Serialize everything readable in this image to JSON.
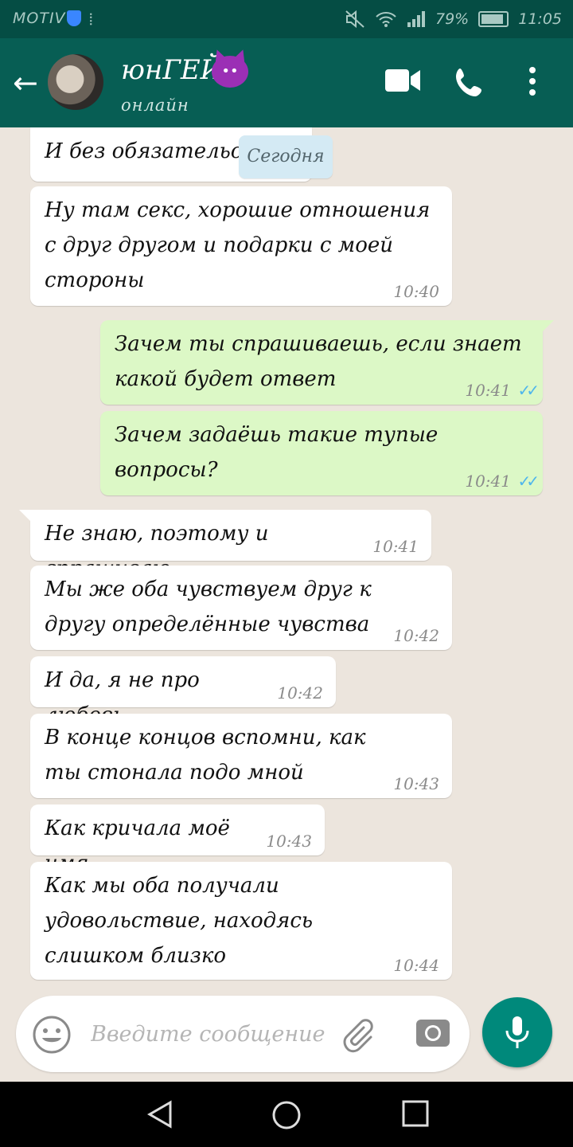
{
  "status_bar": {
    "carrier": "MOTIV",
    "battery": "79%",
    "battery_level": 0.79,
    "time": "11:05"
  },
  "header": {
    "contact_name": "юнГЕЙ",
    "contact_status": "онлайн",
    "colors": {
      "bar": "#075e54",
      "status_bar": "#054d44"
    }
  },
  "chat": {
    "date_divider": "Сегодня",
    "messages": [
      {
        "direction": "in",
        "text": "И без обязательств",
        "time": ""
      },
      {
        "direction": "in",
        "text": "Ну там секс, хорошие отношения с друг другом и подарки с моей стороны",
        "time": "10:40"
      },
      {
        "direction": "out",
        "text": "Зачем ты спрашиваешь, если знает какой будет ответ",
        "time": "10:41",
        "read": true
      },
      {
        "direction": "out",
        "text": "Зачем задаёшь такие тупые вопросы?",
        "time": "10:41",
        "read": true
      },
      {
        "direction": "in",
        "text": "Не знаю, поэтому и спрашиваю",
        "time": "10:41"
      },
      {
        "direction": "in",
        "text": "Мы же оба чувствуем друг к другу определённые чувства",
        "time": "10:42"
      },
      {
        "direction": "in",
        "text": "И да, я не про любовь",
        "time": "10:42"
      },
      {
        "direction": "in",
        "text": "В конце концов вспомни, как ты стонала подо мной",
        "time": "10:43"
      },
      {
        "direction": "in",
        "text": "Как кричала моё имя",
        "time": "10:43"
      },
      {
        "direction": "in",
        "text": "Как мы оба получали удовольствие, находясь слишком близко",
        "time": "10:44"
      }
    ],
    "colors": {
      "incoming": "#ffffff",
      "outgoing": "#dcf8c6",
      "read_ticks": "#4fb6ec"
    }
  },
  "composer": {
    "placeholder": "Введите сообщение",
    "value": "",
    "icons": [
      "emoji-icon",
      "attach-icon",
      "camera-icon",
      "mic-icon"
    ],
    "mic_color": "#00897b"
  },
  "navbar": {
    "icons": [
      "back-triangle-icon",
      "home-circle-icon",
      "recents-square-icon"
    ]
  }
}
